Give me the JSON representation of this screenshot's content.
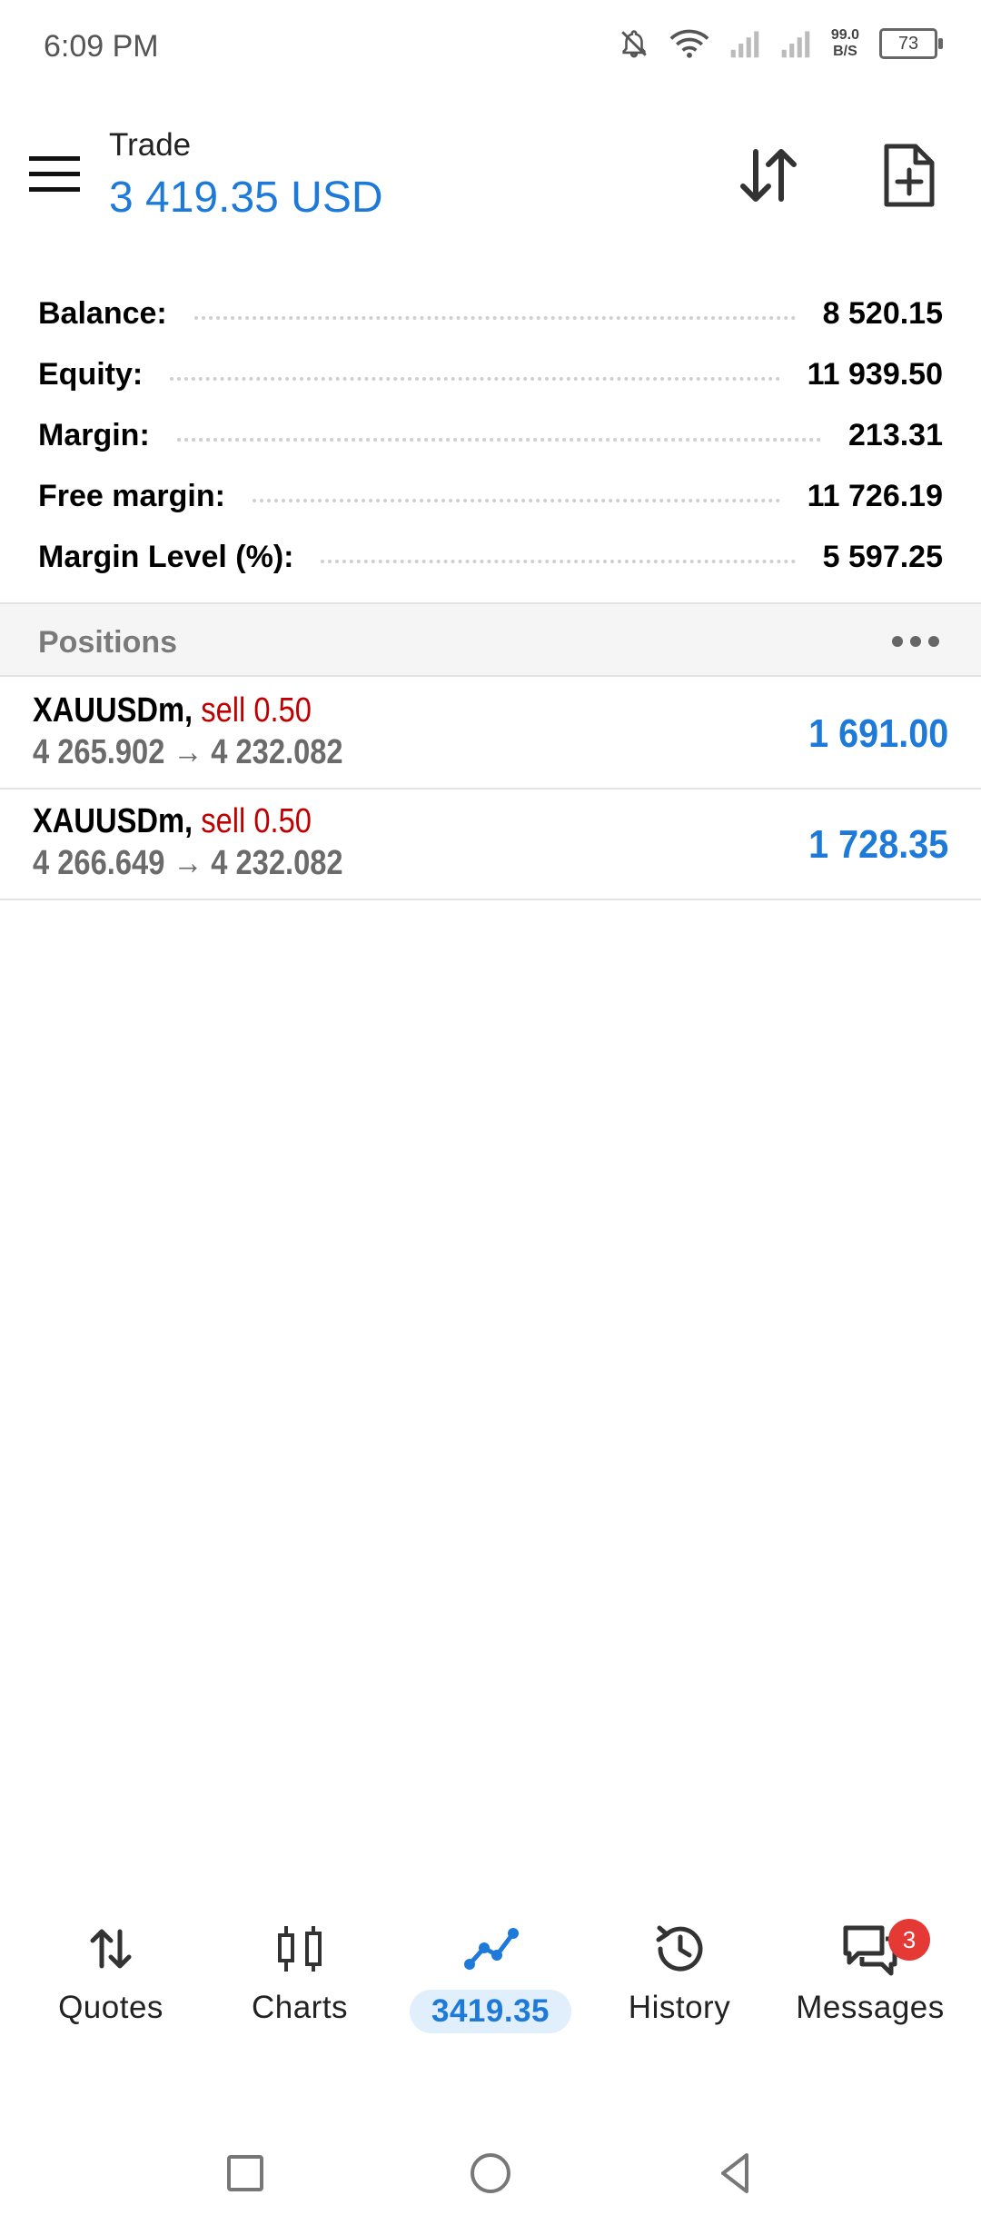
{
  "status_bar": {
    "time": "6:09 PM",
    "network_speed_value": "99.0",
    "network_speed_unit": "B/S",
    "battery_level": "73",
    "icons": [
      "bell-off-icon",
      "wifi-icon",
      "signal-icon",
      "signal-icon"
    ]
  },
  "header": {
    "title": "Trade",
    "balance_text": "3 419.35 USD",
    "icons": [
      "menu-icon",
      "sort-icon",
      "new-order-icon"
    ]
  },
  "account": [
    {
      "label": "Balance:",
      "value": "8 520.15"
    },
    {
      "label": "Equity:",
      "value": "11 939.50"
    },
    {
      "label": "Margin:",
      "value": "213.31"
    },
    {
      "label": "Free margin:",
      "value": "11 726.19"
    },
    {
      "label": "Margin Level (%):",
      "value": "5 597.25"
    }
  ],
  "positions": {
    "title": "Positions",
    "items": [
      {
        "symbol": "XAUUSDm,",
        "side": "sell 0.50",
        "prices": "4 265.902 → 4 232.082",
        "profit": "1 691.00"
      },
      {
        "symbol": "XAUUSDm,",
        "side": "sell 0.50",
        "prices": "4 266.649 → 4 232.082",
        "profit": "1 728.35"
      }
    ]
  },
  "bottom_nav": {
    "items": [
      {
        "label": "Quotes",
        "icon": "quotes-icon",
        "active": false
      },
      {
        "label": "Charts",
        "icon": "charts-icon",
        "active": false
      },
      {
        "label": "3419.35",
        "icon": "trade-icon",
        "active": true
      },
      {
        "label": "History",
        "icon": "history-icon",
        "active": false
      },
      {
        "label": "Messages",
        "icon": "messages-icon",
        "active": false,
        "badge": "3"
      }
    ]
  },
  "colors": {
    "accent": "#1e7ad8",
    "sell": "#c00000",
    "badge": "#e53935"
  }
}
